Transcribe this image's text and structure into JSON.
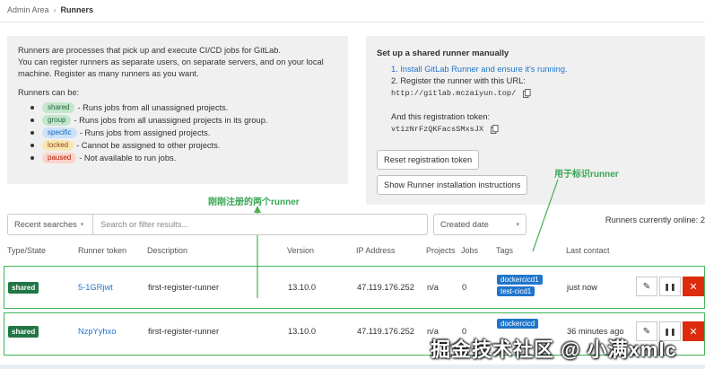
{
  "breadcrumb": {
    "parent": "Admin Area",
    "current": "Runners"
  },
  "info_left": {
    "line1": "Runners are processes that pick up and execute CI/CD jobs for GitLab.",
    "line2": "You can register runners as separate users, on separate servers, and on your local",
    "line3": "machine. Register as many runners as you want.",
    "can_be": "Runners can be:",
    "types": [
      {
        "badge": "shared",
        "desc": "- Runs jobs from all unassigned projects."
      },
      {
        "badge": "group",
        "desc": "- Runs jobs from all unassigned projects in its group."
      },
      {
        "badge": "specific",
        "desc": "- Runs jobs from assigned projects."
      },
      {
        "badge": "locked",
        "desc": "- Cannot be assigned to other projects."
      },
      {
        "badge": "paused",
        "desc": "- Not available to run jobs."
      }
    ]
  },
  "info_right": {
    "title": "Set up a shared runner manually",
    "step1": "1. Install GitLab Runner and ensure it's running.",
    "step2": "2. Register the runner with this URL:",
    "url": "http://gitlab.mczaiyun.top/",
    "token_label": "And this registration token:",
    "token": "vtizNrFzQKFacsSMxsJX",
    "reset_button": "Reset registration token",
    "instructions_button": "Show Runner installation instructions"
  },
  "annotations": {
    "identify": "用于标识runner",
    "registered": "刚刚注册的两个runner"
  },
  "filter": {
    "recent": "Recent searches",
    "placeholder": "Search or filter results...",
    "sort": "Created date",
    "online": "Runners currently online: 2"
  },
  "table": {
    "headers": [
      "Type/State",
      "Runner token",
      "Description",
      "Version",
      "IP Address",
      "Projects",
      "Jobs",
      "Tags",
      "Last contact"
    ],
    "rows": [
      {
        "type": "shared",
        "token": "5-1GRjwt",
        "description": "first-register-runner",
        "version": "13.10.0",
        "ip": "47.119.176.252",
        "projects": "n/a",
        "jobs": "0",
        "tags": [
          "dockercicd1",
          "test-cicd1"
        ],
        "last_contact": "just now"
      },
      {
        "type": "shared",
        "token": "NzpYyhxo",
        "description": "first-register-runner",
        "version": "13.10.0",
        "ip": "47.119.176.252",
        "projects": "n/a",
        "jobs": "0",
        "tags": [
          "dockercicd"
        ],
        "last_contact": "36 minutes ago"
      }
    ]
  },
  "watermark": "掘金技术社区 @ 小满xmlc",
  "colors": {
    "accent_green": "#37a553",
    "link_blue": "#1f75cb",
    "danger": "#dd2b0e"
  }
}
